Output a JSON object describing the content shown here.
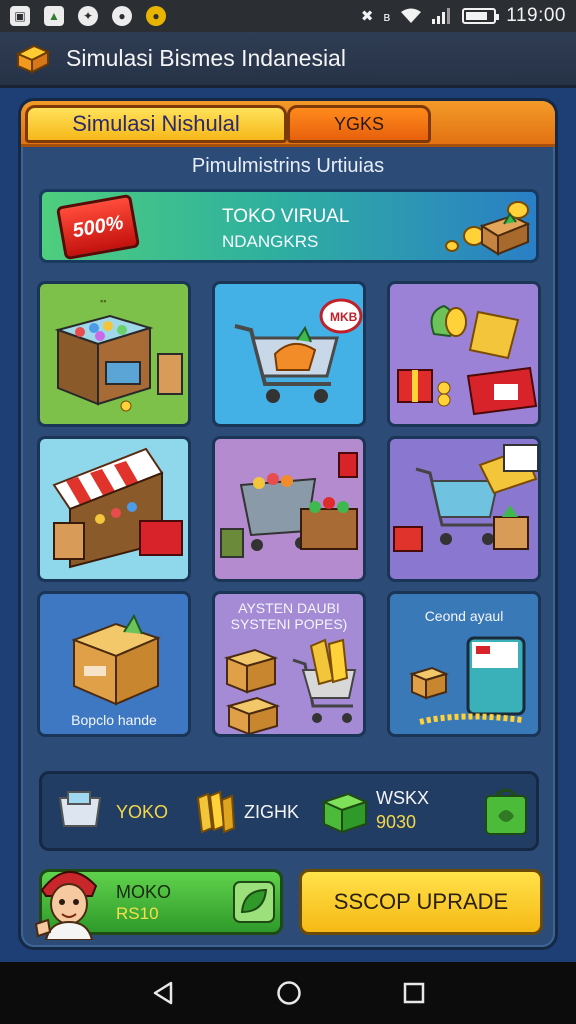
{
  "status_bar": {
    "time": "119:00",
    "left_icons": [
      "gallery-icon",
      "image-icon",
      "app-icon",
      "camera-icon",
      "coin-icon"
    ],
    "right_icons": [
      "mute-icon",
      "bluetooth-icon",
      "wifi-icon",
      "signal-icon",
      "battery-icon"
    ],
    "battery_level": 0.8
  },
  "app_bar": {
    "title": "Simulasi Bismes Indanesial"
  },
  "tabs": [
    {
      "label": "Simulasi Nishulal",
      "active": true
    },
    {
      "label": "YGKS",
      "active": false
    }
  ],
  "panel": {
    "subtitle": "Pimulmistrins Urtiuias"
  },
  "banner": {
    "badge": "500%",
    "line1": "TOKO VIRUAL",
    "line2": "NDANGKRS"
  },
  "tiles": [
    {
      "id": "market-stall",
      "bg": "#7dc14a"
    },
    {
      "id": "shopping-cart",
      "bg": "#43b0e6",
      "bubble": "MKB"
    },
    {
      "id": "gifts-gold",
      "bg": "#9b82d6"
    },
    {
      "id": "awning-shop",
      "bg": "#8fd7ea"
    },
    {
      "id": "produce-cart",
      "bg": "#b58bcf"
    },
    {
      "id": "cart-receipt",
      "bg": "#8a77cf"
    },
    {
      "id": "cardboard-box",
      "bg": "#3f78c2",
      "label": "Bopclo hande"
    },
    {
      "id": "system-boxes",
      "bg": "#a58ad6",
      "label_line1": "AYSTEN DAUBI",
      "label_line2": "SYSTENI POPES)"
    },
    {
      "id": "card-payment",
      "bg": "#3a79b8",
      "label": "Ceond ayaul"
    }
  ],
  "resources": [
    {
      "icon": "cart-icon",
      "label": "YOKO",
      "value": ""
    },
    {
      "icon": "gold-bars-icon",
      "label": "ZIGHK",
      "value": ""
    },
    {
      "icon": "green-crate-icon",
      "label": "WSKX",
      "value": "9030"
    }
  ],
  "buttons": {
    "left": {
      "line1": "MOKO",
      "line2": "RS10"
    },
    "right": {
      "label": "SSCOP UPRADE"
    }
  },
  "colors": {
    "background": "#1d3f76",
    "panel": "#2c4b77",
    "tab_active": "#f6b81a",
    "tab_bar": "#e27212",
    "button_green": "#2f9a2a",
    "button_yellow": "#f6b915",
    "resource_text": "#f3d64a"
  }
}
